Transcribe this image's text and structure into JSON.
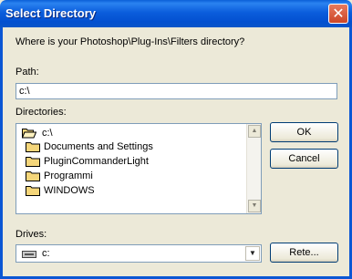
{
  "window": {
    "title": "Select Directory",
    "close_glyph": "✕"
  },
  "prompt": "Where is your Photoshop\\Plug-Ins\\Filters directory?",
  "path": {
    "label": "Path:",
    "value": "c:\\"
  },
  "directories": {
    "label": "Directories:",
    "items": [
      {
        "label": "c:\\",
        "icon": "open-folder-icon"
      },
      {
        "label": "Documents and Settings",
        "icon": "folder-icon"
      },
      {
        "label": "PluginCommanderLight",
        "icon": "folder-icon"
      },
      {
        "label": "Programmi",
        "icon": "folder-icon"
      },
      {
        "label": "WINDOWS",
        "icon": "folder-icon"
      }
    ]
  },
  "buttons": {
    "ok": "OK",
    "cancel": "Cancel",
    "network": "Rete..."
  },
  "drives": {
    "label": "Drives:",
    "selected": "c:"
  },
  "colors": {
    "title_bar": "#0b56d4",
    "dialog_bg": "#ece9d8",
    "folder_yellow": "#f5d67a"
  }
}
